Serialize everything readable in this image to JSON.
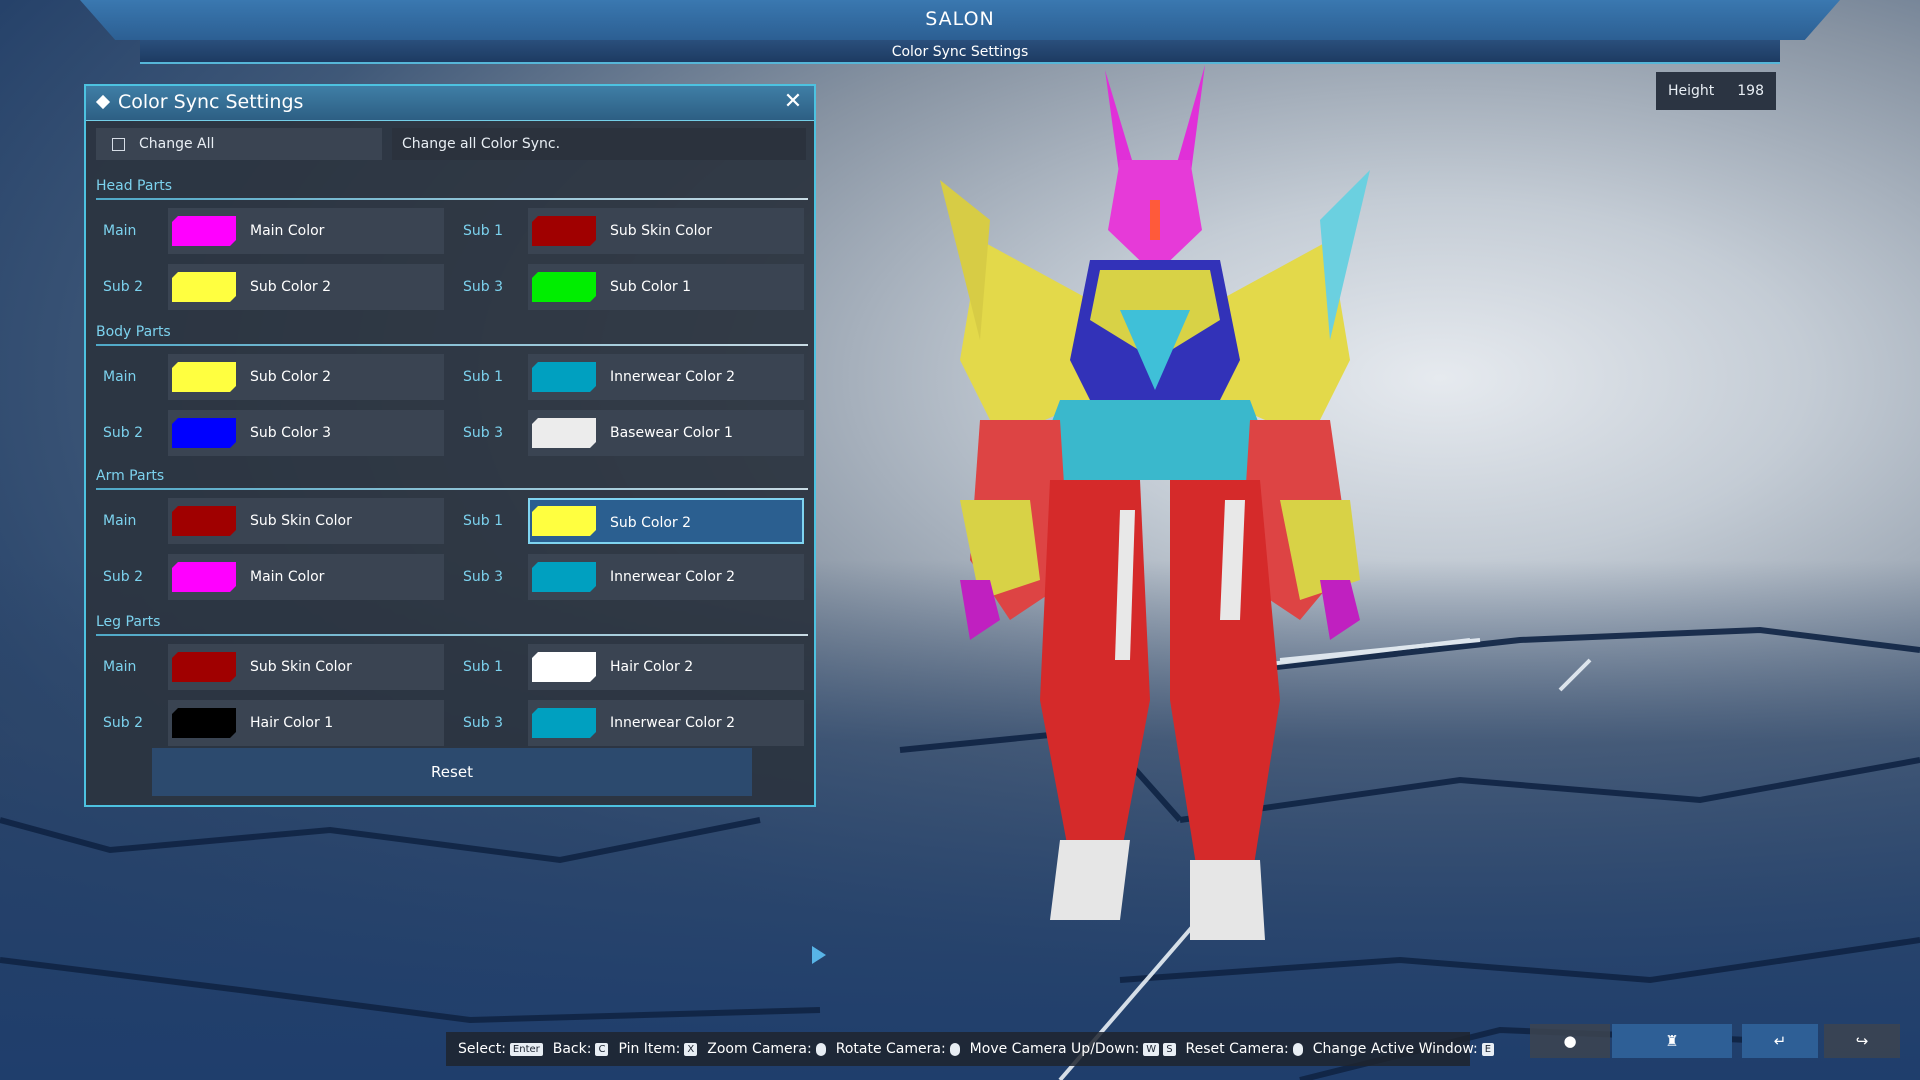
{
  "header": {
    "title": "SALON",
    "subtitle": "Color Sync Settings"
  },
  "height": {
    "label": "Height",
    "value": "198"
  },
  "panel": {
    "title": "Color Sync Settings",
    "change_all": {
      "label": "Change All",
      "checked": false,
      "description": "Change all Color Sync."
    },
    "sections": [
      {
        "title": "Head Parts",
        "slots": [
          {
            "label": "Main",
            "color": "#ff00ff",
            "name": "Main Color"
          },
          {
            "label": "Sub 1",
            "color": "#a00000",
            "name": "Sub Skin Color"
          },
          {
            "label": "Sub 2",
            "color": "#ffff40",
            "name": "Sub Color 2"
          },
          {
            "label": "Sub 3",
            "color": "#00ee00",
            "name": "Sub Color 1"
          }
        ]
      },
      {
        "title": "Body Parts",
        "slots": [
          {
            "label": "Main",
            "color": "#ffff40",
            "name": "Sub Color 2"
          },
          {
            "label": "Sub 1",
            "color": "#00a0c0",
            "name": "Innerwear Color 2"
          },
          {
            "label": "Sub 2",
            "color": "#0000ff",
            "name": "Sub Color 3"
          },
          {
            "label": "Sub 3",
            "color": "#ececec",
            "name": "Basewear Color 1"
          }
        ]
      },
      {
        "title": "Arm Parts",
        "slots": [
          {
            "label": "Main",
            "color": "#a00000",
            "name": "Sub Skin Color"
          },
          {
            "label": "Sub 1",
            "color": "#ffff40",
            "name": "Sub Color 2",
            "selected": true
          },
          {
            "label": "Sub 2",
            "color": "#ff00ff",
            "name": "Main Color"
          },
          {
            "label": "Sub 3",
            "color": "#00a0c0",
            "name": "Innerwear Color 2"
          }
        ]
      },
      {
        "title": "Leg Parts",
        "slots": [
          {
            "label": "Main",
            "color": "#a00000",
            "name": "Sub Skin Color"
          },
          {
            "label": "Sub 1",
            "color": "#ffffff",
            "name": "Hair Color 2"
          },
          {
            "label": "Sub 2",
            "color": "#000000",
            "name": "Hair Color 1"
          },
          {
            "label": "Sub 3",
            "color": "#00a0c0",
            "name": "Innerwear Color 2"
          }
        ]
      }
    ],
    "reset_label": "Reset"
  },
  "help": [
    {
      "text": "Select:",
      "key": "Enter"
    },
    {
      "text": "Back:",
      "key": "C"
    },
    {
      "text": "Pin Item:",
      "key": "X"
    },
    {
      "text": "Zoom Camera:",
      "mouse": true
    },
    {
      "text": "Rotate Camera:",
      "mouse": true
    },
    {
      "text": "Move Camera Up/Down:",
      "key": "W",
      "key2": "S"
    },
    {
      "text": "Reset Camera:",
      "mouse": true
    },
    {
      "text": "Change Active Window:",
      "key": "E"
    }
  ],
  "toolbar": [
    {
      "icon": "record-icon",
      "glyph": "●"
    },
    {
      "icon": "costume-icon",
      "glyph": "♜"
    },
    {
      "icon": "return-icon",
      "glyph": "↵"
    },
    {
      "icon": "redo-icon",
      "glyph": "↪"
    }
  ],
  "colors": {
    "accent": "#4dc2e0",
    "section_label": "#7cd2ee",
    "panel_bg": "#2c3440"
  }
}
